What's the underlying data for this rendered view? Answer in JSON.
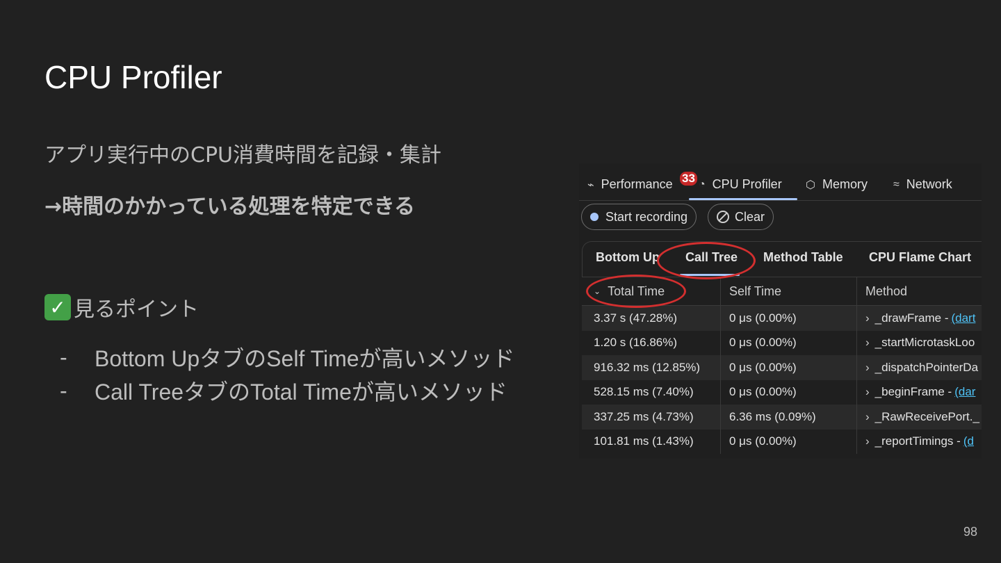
{
  "slide": {
    "title": "CPU Profiler",
    "subtitle": "アプリ実行中のCPU消費時間を記録・集計",
    "emphasis": "→時間のかかっている処理を特定できる",
    "points_heading": "見るポイント",
    "bullets": [
      {
        "dash": "-",
        "text": "Bottom UpタブのSelf Timeが高いメソッド"
      },
      {
        "dash": "-",
        "text": "Call TreeタブのTotal Timeが高いメソッド"
      }
    ],
    "page_number": "98"
  },
  "devtools": {
    "tabs": [
      {
        "label": "Performance",
        "icon": "performance-icon",
        "glyph": "⌁"
      },
      {
        "label": "CPU Profiler",
        "icon": "gauge-icon",
        "glyph": "◔",
        "active": true
      },
      {
        "label": "Memory",
        "icon": "cube-icon",
        "glyph": "⬡"
      },
      {
        "label": "Network",
        "icon": "network-icon",
        "glyph": "≈"
      }
    ],
    "badge": "33",
    "buttons": {
      "start": "Start recording",
      "clear": "Clear"
    },
    "subtabs": [
      "Bottom Up",
      "Call Tree",
      "Method Table",
      "CPU Flame Chart"
    ],
    "active_subtab": "Call Tree",
    "columns": [
      "Total Time",
      "Self Time",
      "Method"
    ],
    "rows": [
      {
        "total": "3.37 s (47.28%)",
        "self": "0 μs (0.00%)",
        "method": "_drawFrame -",
        "link": "(dart"
      },
      {
        "total": "1.20 s (16.86%)",
        "self": "0 μs (0.00%)",
        "method": "_startMicrotaskLoo",
        "link": ""
      },
      {
        "total": "916.32 ms (12.85%)",
        "self": "0 μs (0.00%)",
        "method": "_dispatchPointerDa",
        "link": ""
      },
      {
        "total": "528.15 ms (7.40%)",
        "self": "0 μs (0.00%)",
        "method": "_beginFrame -",
        "link": "(dar"
      },
      {
        "total": "337.25 ms (4.73%)",
        "self": "6.36 ms (0.09%)",
        "method": "_RawReceivePort._",
        "link": ""
      },
      {
        "total": "101.81 ms (1.43%)",
        "self": "0 μs (0.00%)",
        "method": "_reportTimings -",
        "link": "(d"
      }
    ],
    "colors": {
      "accent": "#a8c7fa",
      "highlight_ring": "#d32f2f",
      "badge": "#c62828",
      "link": "#4fc3f7"
    }
  }
}
